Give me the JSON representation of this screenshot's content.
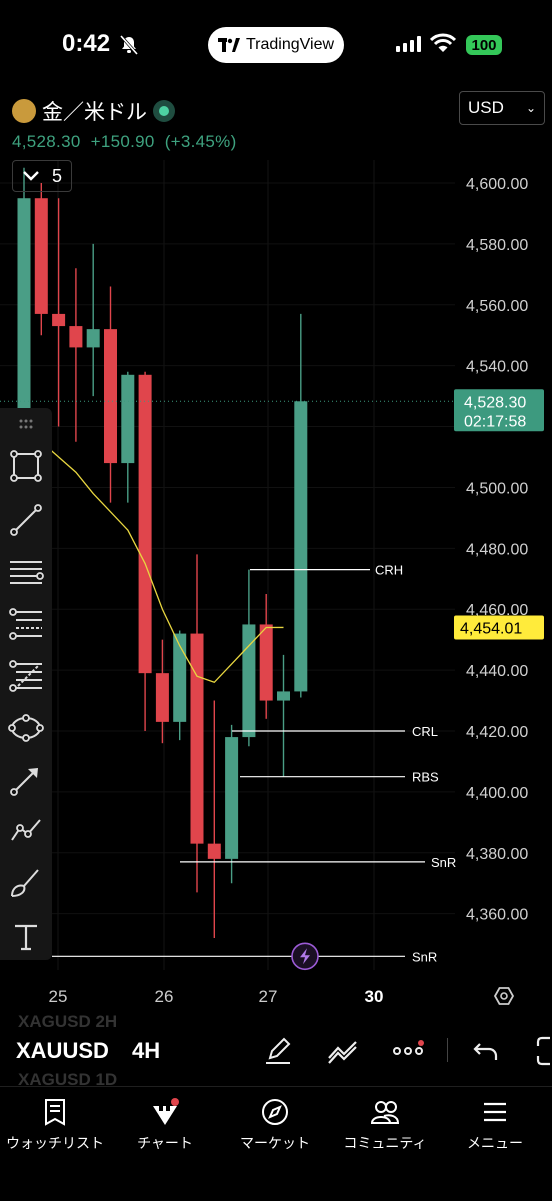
{
  "status_bar": {
    "time": "0:42",
    "pill_label": "TradingView",
    "battery": "100"
  },
  "symbol": {
    "name": "金／米ドル",
    "price": "4,528.30",
    "change": "+150.90",
    "change_pct": "(+3.45%)"
  },
  "currency": "USD",
  "indicators_count": "5",
  "price_axis": {
    "ticks": [
      "4,600.00",
      "4,580.00",
      "4,560.00",
      "4,540.00",
      "4,500.00",
      "4,480.00",
      "4,460.00",
      "4,440.00",
      "4,420.00",
      "4,400.00",
      "4,380.00",
      "4,360.00"
    ],
    "current_price": "4,528.30",
    "countdown": "02:17:58",
    "ma_price": "4,454.01"
  },
  "time_axis": {
    "labels": [
      "25",
      "26",
      "27",
      "30"
    ]
  },
  "levels": [
    "CRH",
    "CRL",
    "RBS",
    "SnR",
    "SnR"
  ],
  "colors": {
    "up": "#4a9e86",
    "down": "#e0454c",
    "price_tag": "#3d9a7f",
    "ma_tag": "#ffeb3b",
    "ma_line": "#e8d640"
  },
  "chart_data": {
    "type": "candlestick",
    "ylim": [
      4340,
      4620
    ],
    "candles": [
      {
        "o": 4500,
        "h": 4605,
        "l": 4490,
        "c": 4595
      },
      {
        "o": 4595,
        "h": 4600,
        "l": 4550,
        "c": 4557
      },
      {
        "o": 4557,
        "h": 4595,
        "l": 4520,
        "c": 4553
      },
      {
        "o": 4553,
        "h": 4572,
        "l": 4515,
        "c": 4546
      },
      {
        "o": 4546,
        "h": 4580,
        "l": 4530,
        "c": 4552
      },
      {
        "o": 4552,
        "h": 4566,
        "l": 4495,
        "c": 4508
      },
      {
        "o": 4508,
        "h": 4538,
        "l": 4495,
        "c": 4537
      },
      {
        "o": 4537,
        "h": 4538,
        "l": 4420,
        "c": 4439
      },
      {
        "o": 4439,
        "h": 4450,
        "l": 4416,
        "c": 4423
      },
      {
        "o": 4423,
        "h": 4453,
        "l": 4417,
        "c": 4452
      },
      {
        "o": 4452,
        "h": 4478,
        "l": 4367,
        "c": 4383
      },
      {
        "o": 4383,
        "h": 4430,
        "l": 4352,
        "c": 4378
      },
      {
        "o": 4378,
        "h": 4422,
        "l": 4370,
        "c": 4418
      },
      {
        "o": 4418,
        "h": 4473,
        "l": 4415,
        "c": 4455
      },
      {
        "o": 4455,
        "h": 4465,
        "l": 4424,
        "c": 4430
      },
      {
        "o": 4430,
        "h": 4445,
        "l": 4405,
        "c": 4433
      },
      {
        "o": 4433,
        "h": 4557,
        "l": 4431,
        "c": 4528.3
      }
    ],
    "moving_average": [
      4520,
      4515,
      4510,
      4505,
      4498,
      4492,
      4486,
      4475,
      4460,
      4448,
      4438,
      4436,
      4442,
      4448,
      4454,
      4454.01
    ]
  },
  "bottom": {
    "ticker": "XAUUSD",
    "interval": "4H",
    "ghost_top": "XAGUSD  2H",
    "ghost_bottom": "XAGUSD  1D"
  },
  "nav": [
    {
      "label": "ウォッチリスト",
      "icon": "watchlist-icon"
    },
    {
      "label": "チャート",
      "icon": "chart-icon"
    },
    {
      "label": "マーケット",
      "icon": "compass-icon"
    },
    {
      "label": "コミュニティ",
      "icon": "community-icon"
    },
    {
      "label": "メニュー",
      "icon": "menu-icon"
    }
  ]
}
